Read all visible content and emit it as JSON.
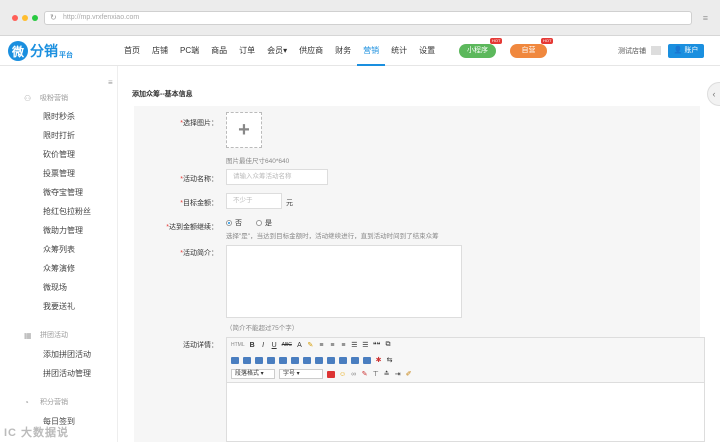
{
  "browser": {
    "url": "http://mp.vrxfenxiao.com"
  },
  "brand": {
    "mark": "微",
    "name": "分销",
    "sub": "平台",
    "color": "#1a8fdf"
  },
  "nav": {
    "items": [
      "首页",
      "店铺",
      "PC端",
      "商品",
      "订单",
      "会员",
      "供应商",
      "财务",
      "营销",
      "统计",
      "设置"
    ],
    "member_arrow": "▾",
    "active": "营销",
    "miniapp": "小程序",
    "app": "自营",
    "hot": "HOT",
    "shop": "测试店铺",
    "account": "账户"
  },
  "sidebar": {
    "sections": [
      {
        "title": "吸粉营销",
        "icon": "people-icon",
        "items": [
          "限时秒杀",
          "限时打折",
          "砍价管理",
          "投票管理",
          "微夺宝管理",
          "抢红包拉粉丝",
          "微助力管理",
          "众筹列表",
          "众筹演修",
          "微现场",
          "我要送礼"
        ]
      },
      {
        "title": "拼团活动",
        "icon": "grid-icon",
        "items": [
          "添加拼团活动",
          "拼团活动管理"
        ]
      },
      {
        "title": "积分营销",
        "icon": "coin-icon",
        "items": [
          "每日签到"
        ]
      }
    ]
  },
  "page": {
    "title": "添加众筹--基本信息",
    "image_label": "选择图片：",
    "image_hint": "图片最佳尺寸640*640",
    "name_label": "活动名称：",
    "name_placeholder": "请输入众筹活动名称",
    "target_label": "目标金额：",
    "target_placeholder": "不少于",
    "target_unit": "元",
    "continue_label": "达到金额继续：",
    "radio_no": "否",
    "radio_yes": "是",
    "radio_selected": "否",
    "continue_hint": "选择\"是\"，当达到目标金额时，活动继续进行，直到活动时间到了结束众筹",
    "intro_label": "活动简介：",
    "intro_hint": "（简介不能超过75个字）",
    "detail_label": "活动详情："
  },
  "editor": {
    "row1": [
      "HTML",
      "B",
      "I",
      "U",
      "ABC",
      "A",
      "✎",
      "≡",
      "≡",
      "≡",
      "☰",
      "☰",
      "❝❝",
      "⧉"
    ],
    "paragraph": "段落格式",
    "font_size": "字号"
  },
  "watermark": "IC 大数据说",
  "colors": {
    "accent": "#1a8fdf",
    "green": "#5cb85c",
    "orange": "#f0883e",
    "required": "#e53935"
  }
}
